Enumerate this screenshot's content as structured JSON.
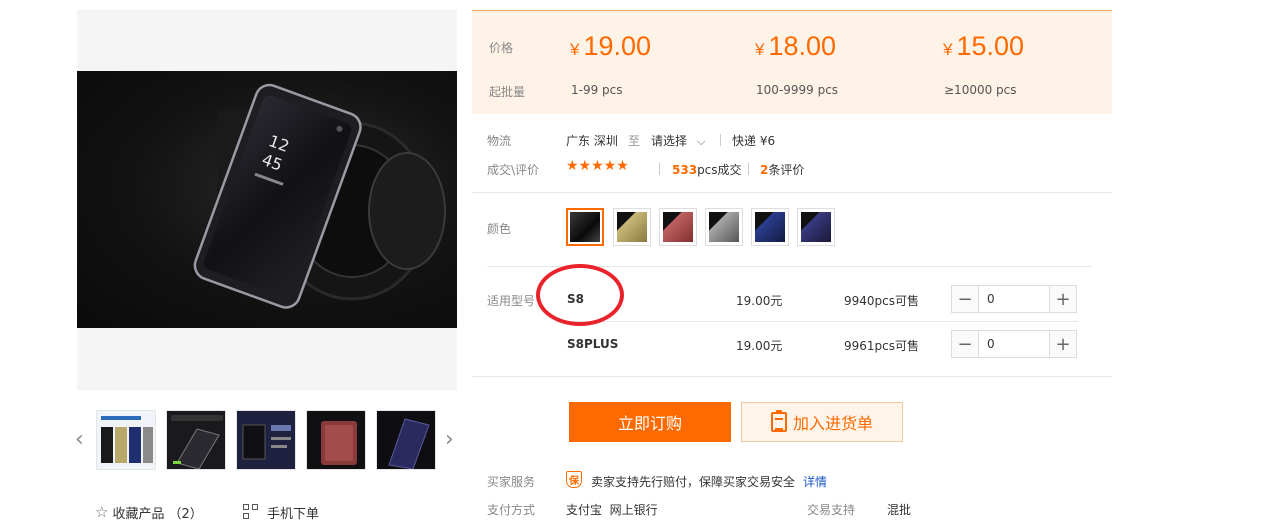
{
  "gallery": {
    "main_image_alt": "phone flip cover on camera lens",
    "thumbnails": [
      "thumb-1",
      "thumb-2",
      "thumb-3",
      "thumb-4",
      "thumb-5"
    ],
    "prev_arrow": "‹",
    "next_arrow": "›",
    "favorite_label": "收藏产品",
    "favorite_count": "（2）",
    "mobile_order_label": "手机下单"
  },
  "price_panel": {
    "price_label": "价格",
    "moq_label": "起批量",
    "currency": "¥",
    "tiers": [
      {
        "price": "19.00",
        "range": "1-99  pcs"
      },
      {
        "price": "18.00",
        "range": "100-9999  pcs"
      },
      {
        "price": "15.00",
        "range": "≥10000  pcs"
      }
    ]
  },
  "logistics": {
    "label": "物流",
    "origin": "广东 深圳",
    "to": "至",
    "destination": "请选择",
    "shipping": "快递 ¥6"
  },
  "deals": {
    "label": "成交\\评价",
    "stars": "★★★★★",
    "sold_count": "533",
    "sold_suffix": "pcs成交",
    "review_count": "2",
    "review_suffix": "条评价"
  },
  "color": {
    "label": "颜色",
    "swatches": [
      {
        "name": "black",
        "color": "#1a1a1a"
      },
      {
        "name": "gold",
        "color": "#b8a86a"
      },
      {
        "name": "rose",
        "color": "#b05a5a"
      },
      {
        "name": "silver",
        "color": "#8a8a8a"
      },
      {
        "name": "blue",
        "color": "#1e2e6e"
      },
      {
        "name": "purple",
        "color": "#2a2660"
      }
    ]
  },
  "models": {
    "label": "适用型号",
    "rows": [
      {
        "name": "S8",
        "price": "19.00元",
        "stock": "9940",
        "stock_suffix": "pcs可售",
        "qty": "0"
      },
      {
        "name": "S8PLUS",
        "price": "19.00元",
        "stock": "9961",
        "stock_suffix": "pcs可售",
        "qty": "0"
      }
    ]
  },
  "actions": {
    "buy_now": "立即订购",
    "add_to_list": "加入进货单"
  },
  "service": {
    "label": "买家服务",
    "badge": "保",
    "text": "卖家支持先行赔付，保障买家交易安全",
    "details_link": "详情"
  },
  "payment": {
    "label": "支付方式",
    "methods": "支付宝  网上银行",
    "support_label": "交易支持",
    "support_value": "混批"
  },
  "colors": {
    "accent": "#ff6a00",
    "annotation": "#e8232a",
    "price_bg": "#fff3e8"
  }
}
